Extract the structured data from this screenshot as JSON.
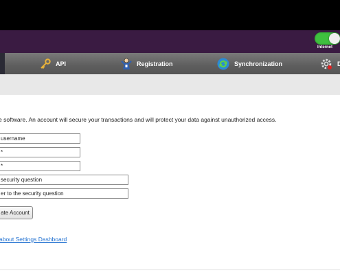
{
  "header": {
    "toggle_label": "Internet",
    "toggle_on": true
  },
  "nav": {
    "items": [
      {
        "label": "API",
        "icon": "key-icon"
      },
      {
        "label": "Registration",
        "icon": "registration-icon"
      },
      {
        "label": "Synchronization",
        "icon": "sync-icon"
      },
      {
        "label": "D",
        "icon": "gear-icon"
      }
    ]
  },
  "form": {
    "intro": "e software. An account will secure your transactions and will protect your data against unauthorized access.",
    "fields": [
      {
        "placeholder": "username"
      },
      {
        "placeholder": "*"
      },
      {
        "placeholder": "*"
      },
      {
        "placeholder": "security question"
      },
      {
        "placeholder": "er to the security question"
      }
    ],
    "submit_label": "ate Account"
  },
  "footer": {
    "link_text": "about Settings Dashboard"
  },
  "colors": {
    "purple_bar": "#3a1b42",
    "toggle_green": "#3fbf3f",
    "nav_gray": "#666666",
    "link_blue": "#1e6fd0"
  }
}
